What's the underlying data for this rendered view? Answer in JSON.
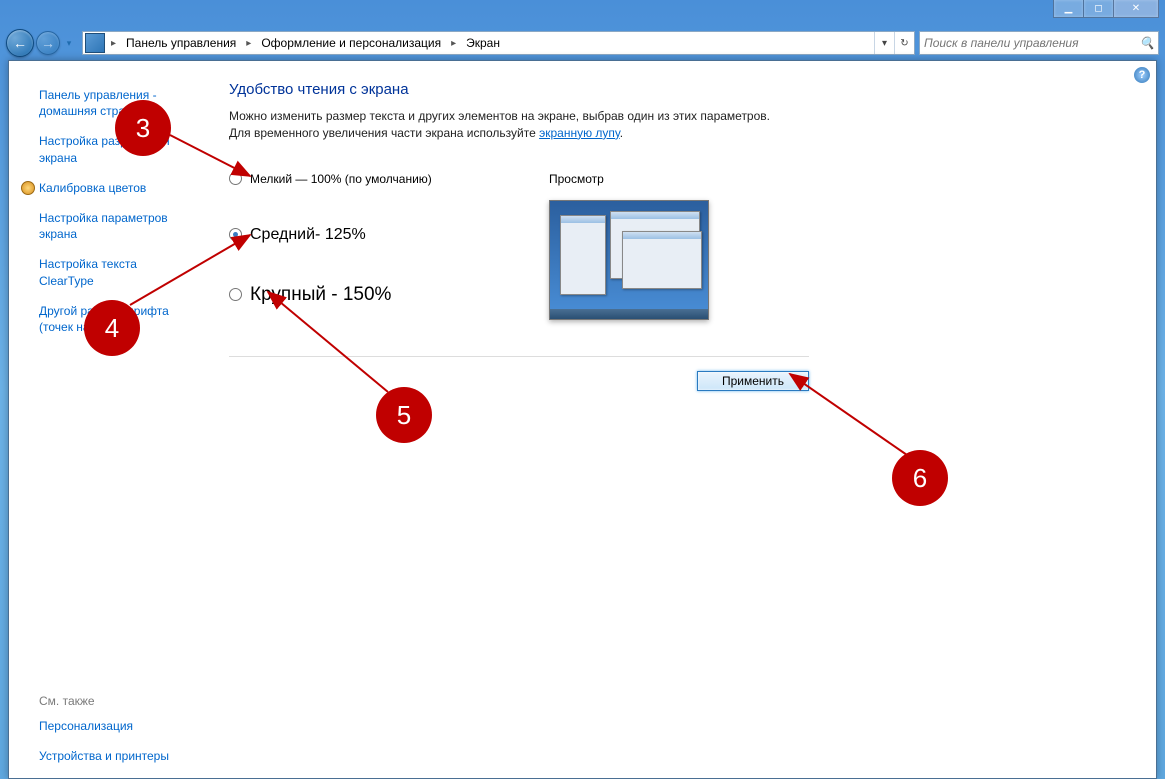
{
  "titlebar": {
    "min_glyph": "▁",
    "max_glyph": "◻",
    "close_glyph": "✕"
  },
  "addrbar": {
    "back_glyph": "←",
    "forward_glyph": "→",
    "dropdown_glyph": "▾",
    "refresh_glyph": "↻",
    "segments": [
      "Панель управления",
      "Оформление и персонализация",
      "Экран"
    ],
    "arrow_glyph": "▸"
  },
  "search": {
    "placeholder": "Поиск в панели управления",
    "icon_glyph": "🔍"
  },
  "help_glyph": "?",
  "sidebar": {
    "links": [
      "Панель управления - домашняя страница",
      "Настройка разрешения экрана",
      "Калибровка цветов",
      "Настройка параметров экрана",
      "Настройка текста ClearType",
      "Другой размер шрифта (точек на дюйм)"
    ],
    "see_also_title": "См. также",
    "see_also_links": [
      "Персонализация",
      "Устройства и принтеры"
    ]
  },
  "main": {
    "heading": "Удобство чтения с экрана",
    "desc_line1": "Можно изменить размер текста и других элементов на экране, выбрав один из этих параметров. Для временного увеличения части экрана используйте ",
    "desc_link": "экранную лупу",
    "desc_after": ".",
    "options": [
      {
        "label": "Мелкий — 100% (по умолчанию)",
        "checked": false,
        "size": ""
      },
      {
        "label": "Средний- 125%",
        "checked": true,
        "size": "big1"
      },
      {
        "label": "Крупный - 150%",
        "checked": false,
        "size": "big2"
      }
    ],
    "preview_label": "Просмотр",
    "apply_label": "Применить"
  },
  "annotations": {
    "badges": [
      "3",
      "4",
      "5",
      "6"
    ]
  }
}
